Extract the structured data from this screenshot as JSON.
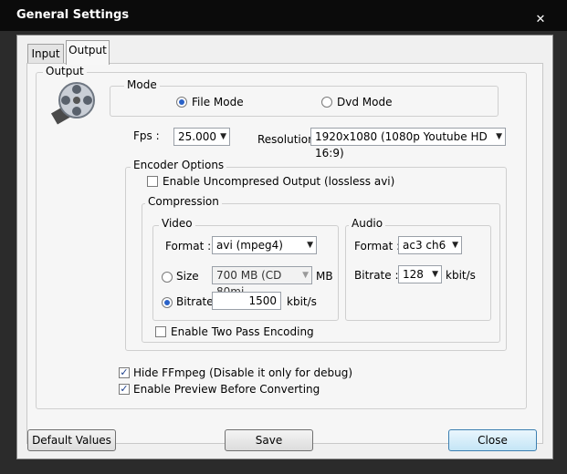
{
  "window": {
    "title": "General Settings",
    "close_glyph": "✕"
  },
  "tabs": [
    {
      "label": "Input"
    },
    {
      "label": "Output"
    }
  ],
  "output_group": {
    "title": "Output"
  },
  "mode": {
    "title": "Mode",
    "options": [
      {
        "label": "File Mode",
        "checked": true
      },
      {
        "label": "Dvd Mode",
        "checked": false
      }
    ]
  },
  "fps": {
    "label": "Fps :",
    "value": "25.000"
  },
  "resolution": {
    "label": "Resolution :",
    "value": "1920x1080 (1080p Youtube HD 16:9)"
  },
  "encoder": {
    "title": "Encoder Options",
    "lossless_label": "Enable Uncompresed Output (lossless avi)",
    "lossless_checked": false,
    "compression": {
      "title": "Compression",
      "video": {
        "title": "Video",
        "format_label": "Format :",
        "format_value": "avi (mpeg4)",
        "size_label": "Size",
        "size_value": "700 MB (CD 80mi",
        "size_unit": "MB",
        "bitrate_label": "Bitrate",
        "bitrate_value": "1500",
        "bitrate_unit": "kbit/s"
      },
      "audio": {
        "title": "Audio",
        "format_label": "Format :",
        "format_value": "ac3 ch6",
        "bitrate_label": "Bitrate :",
        "bitrate_value": "128",
        "bitrate_unit": "kbit/s"
      },
      "two_pass_label": "Enable Two Pass Encoding",
      "two_pass_checked": false
    }
  },
  "hide_ffmpeg": {
    "label": "Hide FFmpeg (Disable it only for debug)",
    "checked": true
  },
  "enable_preview": {
    "label": "Enable Preview Before Converting",
    "checked": true
  },
  "buttons": {
    "default_values": "Default Values",
    "save": "Save",
    "close": "Close"
  },
  "colors": {
    "accent": "#2a62c8",
    "titlebar": "#0b0b0b",
    "panel": "#f0f0f0"
  }
}
